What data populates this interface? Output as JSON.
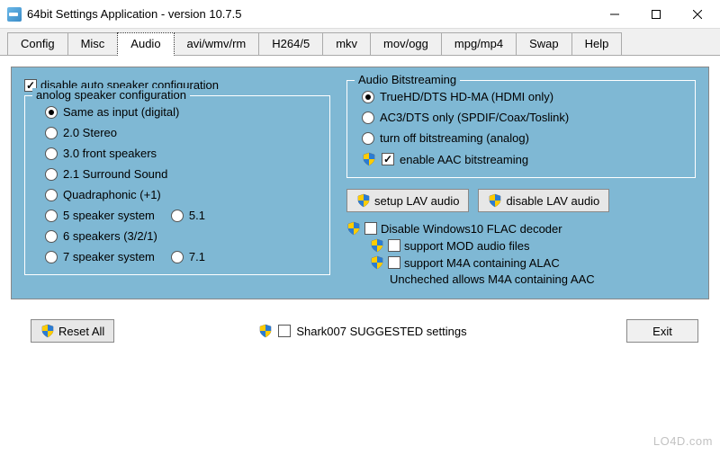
{
  "window": {
    "title": "64bit Settings Application - version 10.7.5"
  },
  "tabs": [
    {
      "label": "Config"
    },
    {
      "label": "Misc"
    },
    {
      "label": "Audio",
      "active": true
    },
    {
      "label": "avi/wmv/rm"
    },
    {
      "label": "H264/5"
    },
    {
      "label": "mkv"
    },
    {
      "label": "mov/ogg"
    },
    {
      "label": "mpg/mp4"
    },
    {
      "label": "Swap"
    },
    {
      "label": "Help"
    }
  ],
  "left": {
    "disable_auto": {
      "label": "disable auto speaker configuration",
      "checked": true
    },
    "analog_legend": "anolog speaker configuration",
    "options": [
      {
        "label": "Same as input (digital)",
        "checked": true
      },
      {
        "label": "2.0 Stereo"
      },
      {
        "label": "3.0 front speakers"
      },
      {
        "label": "2.1 Surround Sound"
      },
      {
        "label": "Quadraphonic (+1)"
      },
      {
        "label": "5 speaker system",
        "extra": "5.1"
      },
      {
        "label": "6 speakers (3/2/1)"
      },
      {
        "label": "7 speaker system",
        "extra": "7.1"
      }
    ]
  },
  "right": {
    "bitstream_legend": "Audio Bitstreaming",
    "bitstream_options": [
      {
        "label": "TrueHD/DTS HD-MA (HDMI only)",
        "checked": true
      },
      {
        "label": "AC3/DTS only (SPDIF/Coax/Toslink)"
      },
      {
        "label": "turn off bitstreaming (analog)"
      }
    ],
    "enable_aac": {
      "label": "enable AAC bitstreaming",
      "checked": true
    },
    "btn_setup": "setup LAV audio",
    "btn_disable": "disable LAV audio",
    "flac": {
      "label": "Disable Windows10 FLAC decoder",
      "checked": false
    },
    "mod": {
      "label": "support MOD audio files",
      "checked": false
    },
    "m4a": {
      "label": "support M4A containing ALAC",
      "checked": false
    },
    "info": "Uncheched allows M4A containing AAC"
  },
  "footer": {
    "reset": "Reset All",
    "suggested": "Shark007 SUGGESTED settings",
    "exit": "Exit"
  },
  "watermark": "LO4D.com"
}
